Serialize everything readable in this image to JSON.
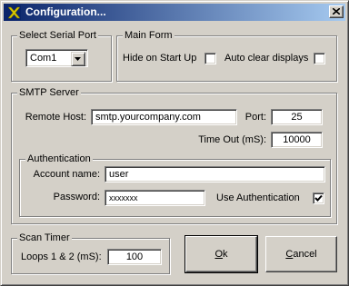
{
  "window": {
    "title": "Configuration..."
  },
  "serial_port": {
    "legend": "Select Serial Port",
    "selected": "Com1"
  },
  "main_form": {
    "legend": "Main Form",
    "hide_on_start_label": "Hide on Start Up",
    "hide_on_start_checked": false,
    "auto_clear_label": "Auto clear displays",
    "auto_clear_checked": false
  },
  "smtp": {
    "legend": "SMTP Server",
    "remote_host_label": "Remote Host:",
    "remote_host_value": "smtp.yourcompany.com",
    "port_label": "Port:",
    "port_value": "25",
    "timeout_label": "Time Out (mS):",
    "timeout_value": "10000",
    "auth": {
      "legend": "Authentication",
      "account_label": "Account name:",
      "account_value": "user",
      "password_label": "Password:",
      "password_value": "xxxxxxx",
      "use_auth_label": "Use Authentication",
      "use_auth_checked": true
    }
  },
  "scan_timer": {
    "legend": "Scan Timer",
    "loops_label": "Loops 1 & 2 (mS):",
    "loops_value": "100"
  },
  "buttons": {
    "ok_accel": "O",
    "ok_rest": "k",
    "cancel_accel": "C",
    "cancel_rest": "ancel"
  },
  "icons": {
    "title": "x-logo-icon",
    "close": "close-icon",
    "dropdown": "chevron-down-icon",
    "check": "checkmark-icon"
  },
  "colors": {
    "title_start": "#0a246a",
    "title_end": "#a6caf0",
    "face": "#d4d0c8",
    "logo": "#d4c300"
  }
}
